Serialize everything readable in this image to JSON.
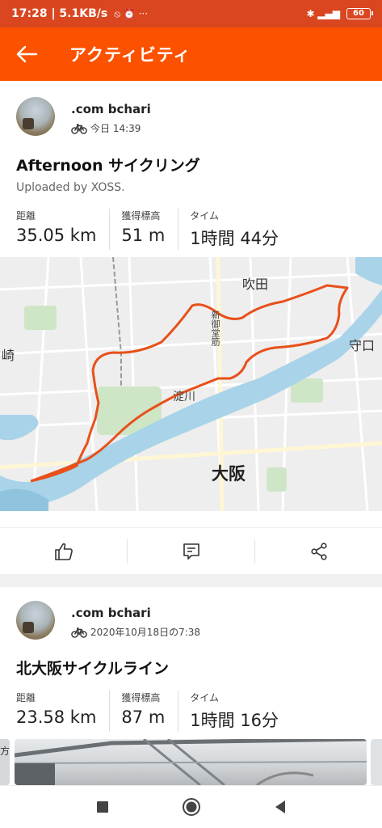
{
  "status": {
    "time_speed": "17:28 | 5.1KB/s",
    "status_icons": "⦸ ⏰ ···",
    "signal": "✱ ▂▄▆",
    "battery": "60"
  },
  "appbar": {
    "title": "アクティビティ"
  },
  "activities": [
    {
      "user": ".com bchari",
      "when": "今日 14:39",
      "title": "Afternoon サイクリング",
      "subtitle": "Uploaded by XOSS.",
      "stats": [
        {
          "label": "距離",
          "value": "35.05 km"
        },
        {
          "label": "獲得標高",
          "value": "51 m"
        },
        {
          "label": "タイム",
          "value": "1時間 44分"
        }
      ],
      "map_labels": {
        "suita": "吹田",
        "moriguchi": "守口",
        "saki": "崎",
        "yodogawa": "淀川",
        "osaka": "大阪",
        "midosuji": "新御堂筋"
      }
    },
    {
      "user": ".com bchari",
      "when": "2020年10月18日の7:38",
      "title": "北大阪サイクルライン",
      "stats": [
        {
          "label": "距離",
          "value": "23.58 km"
        },
        {
          "label": "獲得標高",
          "value": "87 m"
        },
        {
          "label": "タイム",
          "value": "1時間 16分"
        }
      ],
      "photo_edge_text": "方"
    }
  ],
  "colors": {
    "accent": "#fc5200",
    "route": "#e8501a",
    "water": "#a9d3e8"
  }
}
